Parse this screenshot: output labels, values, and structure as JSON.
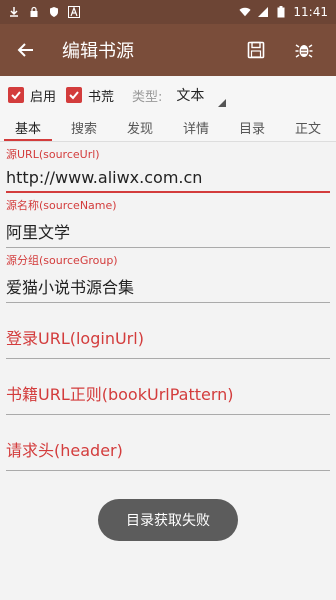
{
  "status_bar": {
    "time": "11:41",
    "left_icons": [
      "download-icon",
      "lock-icon",
      "shield-icon",
      "a-icon"
    ],
    "right_icons": [
      "wifi-icon",
      "signal-icon",
      "battery-icon"
    ]
  },
  "app_bar": {
    "title": "编辑书源",
    "back_icon": "arrow-back-icon",
    "actions": [
      "save-icon",
      "bug-icon"
    ]
  },
  "options": {
    "enable_label": "启用",
    "enable_checked": true,
    "book_label": "书荒",
    "book_checked": true,
    "type_label": "类型:",
    "type_value": "文本"
  },
  "tabs": [
    "基本",
    "搜索",
    "发现",
    "详情",
    "目录",
    "正文"
  ],
  "fields": {
    "source_url": {
      "label": "源URL(sourceUrl)",
      "value": "http://www.aliwx.com.cn"
    },
    "source_name": {
      "label": "源名称(sourceName)",
      "value": "阿里文学"
    },
    "source_group": {
      "label": "源分组(sourceGroup)",
      "value": "爱猫小说书源合集"
    },
    "login_url": {
      "placeholder": "登录URL(loginUrl)"
    },
    "book_url_pattern": {
      "placeholder": "书籍URL正则(bookUrlPattern)"
    },
    "header": {
      "placeholder": "请求头(header)"
    }
  },
  "toast": {
    "text": "目录获取失败"
  },
  "colors": {
    "accent": "#d33c3c",
    "appbar": "#7a4d3a",
    "statusbar": "#6d4535"
  }
}
